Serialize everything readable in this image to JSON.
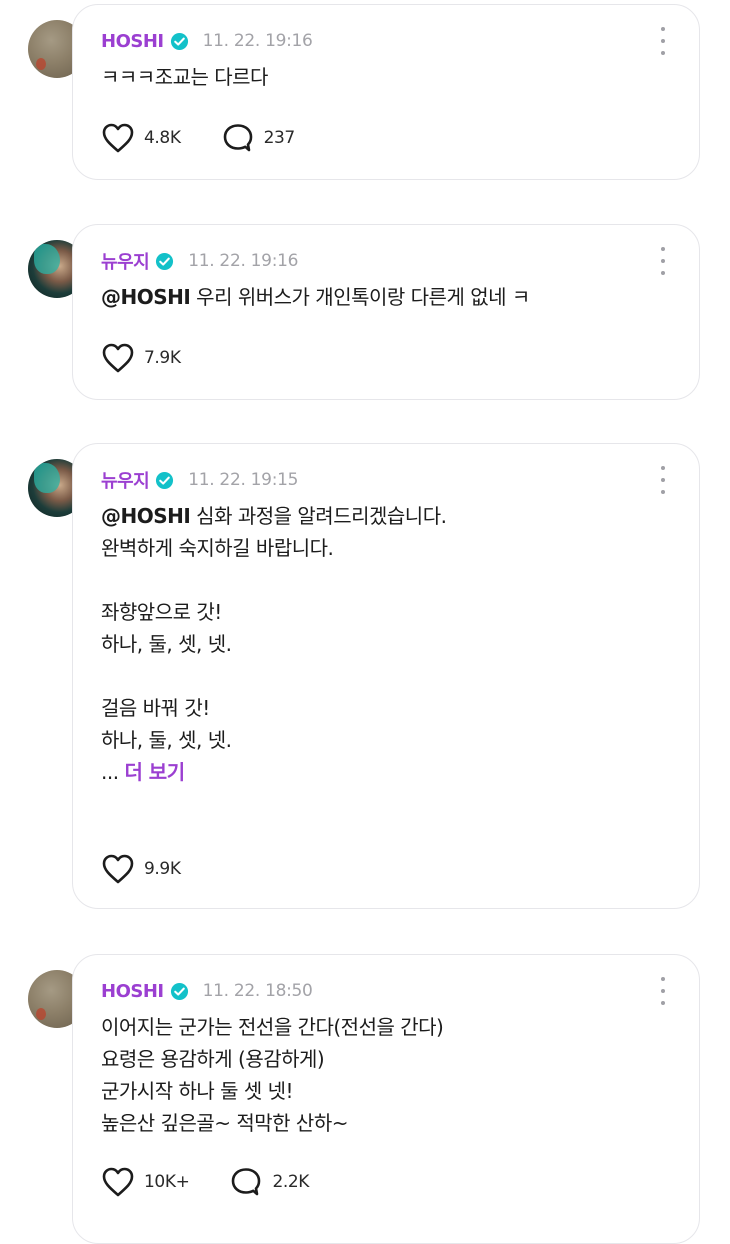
{
  "posts": [
    {
      "author": "HOSHI",
      "time": "11. 22. 19:16",
      "mention": "",
      "lines": "ㅋㅋㅋ조교는 다르다",
      "see_more_prefix": "",
      "see_more": "",
      "likes": "4.8K",
      "comments": "237"
    },
    {
      "author": "뉴우지",
      "time": "11. 22. 19:16",
      "mention": "@HOSHI",
      "lines": " 우리 위버스가 개인톡이랑 다른게 없네 ㅋ",
      "see_more_prefix": "",
      "see_more": "",
      "likes": "7.9K",
      "comments": ""
    },
    {
      "author": "뉴우지",
      "time": "11. 22. 19:15",
      "mention": "@HOSHI",
      "lines": " 심화 과정을 알려드리겠습니다.\n완벽하게 숙지하길 바랍니다.\n\n좌향앞으로 갓!\n하나, 둘, 셋, 넷.\n\n걸음 바꿔 갓!\n하나, 둘, 셋, 넷.\n",
      "see_more_prefix": "... ",
      "see_more": "더 보기",
      "likes": "9.9K",
      "comments": ""
    },
    {
      "author": "HOSHI",
      "time": "11. 22. 18:50",
      "mention": "",
      "lines": "이어지는 군가는 전선을 간다(전선을 간다)\n요령은 용감하게 (용감하게)\n군가시작 하나 둘 셋 넷!\n높은산 깊은골~ 적막한 산하~",
      "see_more_prefix": "",
      "see_more": "",
      "likes": "10K+",
      "comments": "2.2K"
    }
  ],
  "colors": {
    "author": "#9b3fd1",
    "verified_badge": "#13c1c9",
    "timestamp": "#a3a3a8",
    "card_border": "#e6e6ea"
  },
  "icons": [
    "verified-badge-icon",
    "more-options-icon",
    "heart-icon",
    "comment-icon"
  ]
}
